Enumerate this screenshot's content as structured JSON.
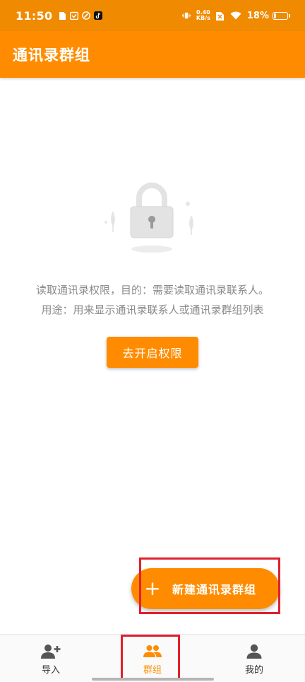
{
  "status_bar": {
    "time": "11:50",
    "net_speed_value": "0.40",
    "net_speed_unit": "KB/s",
    "battery_percent": "18%",
    "battery_level": 0.18
  },
  "app_bar": {
    "title": "通讯录群组"
  },
  "permission": {
    "line1": "读取通讯录权限，目的：需要读取通讯录联系人。",
    "line2": "用途：用来显示通讯录联系人或通讯录群组列表",
    "button_label": "去开启权限"
  },
  "fab": {
    "plus": "+",
    "label": "新建通讯录群组"
  },
  "bottom_nav": {
    "items": [
      {
        "label": "导入",
        "icon": "person-add-icon"
      },
      {
        "label": "群组",
        "icon": "group-icon"
      },
      {
        "label": "我的",
        "icon": "person-icon"
      }
    ],
    "active_index": 1
  },
  "colors": {
    "primary": "#ff8c00",
    "status_bar": "#f08a00",
    "highlight": "#e0202e",
    "text_muted": "#8a8a8a"
  }
}
